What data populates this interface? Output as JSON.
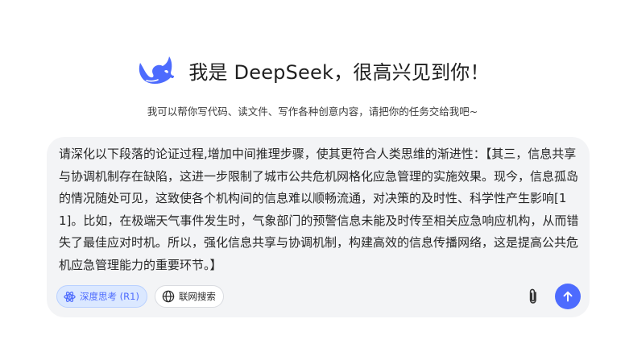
{
  "header": {
    "title": "我是 DeepSeek，很高兴见到你！",
    "logo_icon": "deepseek-whale-icon",
    "subtitle": "我可以帮你写代码、读文件、写作各种创意内容，请把你的任务交给我吧~"
  },
  "composer": {
    "text": "请深化以下段落的论证过程,增加中间推理步骤，使其更符合人类思维的渐进性：【其三，信息共享与协调机制存在缺陷，这进一步限制了城市公共危机网格化应急管理的实施效果。现今，信息孤岛的情况随处可见，这致使各个机构间的信息难以顺畅流通，对决策的及时性、科学性产生影响[11]。比如，在极端天气事件发生时，气象部门的预警信息未能及时传至相关应急响应机构，从而错失了最佳应对时机。所以，强化信息共享与协调机制，构建高效的信息传播网络，这是提高公共危机应急管理能力的重要环节。】",
    "deep_think_label": "深度思考 (R1)",
    "deep_think_icon": "atom-icon",
    "web_search_label": "联网搜索",
    "web_search_icon": "globe-icon",
    "attach_icon": "paperclip-icon",
    "send_icon": "arrow-up-icon"
  },
  "colors": {
    "accent": "#4d6bfe",
    "composer_bg": "#f3f4f6",
    "deep_think_bg": "#dbe8ff"
  }
}
